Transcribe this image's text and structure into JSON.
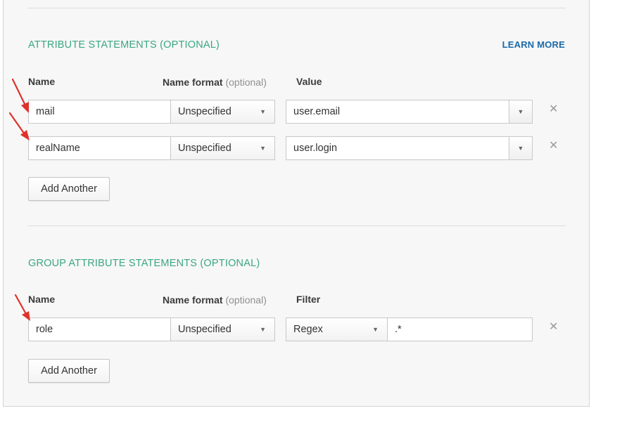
{
  "attribute_statements": {
    "title": "ATTRIBUTE STATEMENTS (OPTIONAL)",
    "learn_more": "LEARN MORE",
    "col_name": "Name",
    "col_format": "Name format",
    "col_format_opt": "(optional)",
    "col_value": "Value",
    "rows": [
      {
        "name": "mail",
        "format": "Unspecified",
        "value": "user.email"
      },
      {
        "name": "realName",
        "format": "Unspecified",
        "value": "user.login"
      }
    ],
    "add_button": "Add Another"
  },
  "group_attribute_statements": {
    "title": "GROUP ATTRIBUTE STATEMENTS (OPTIONAL)",
    "col_name": "Name",
    "col_format": "Name format",
    "col_format_opt": "(optional)",
    "col_filter": "Filter",
    "rows": [
      {
        "name": "role",
        "format": "Unspecified",
        "filter_type": "Regex",
        "filter_value": ".*"
      }
    ],
    "add_button": "Add Another"
  },
  "icons": {
    "remove": "close-icon",
    "dropdown": "chevron-down-icon",
    "annotation": "red-arrow-annotation"
  },
  "colors": {
    "section_title": "#3aa782",
    "link": "#1a6aa8",
    "annotation_arrow": "#e0312b"
  }
}
